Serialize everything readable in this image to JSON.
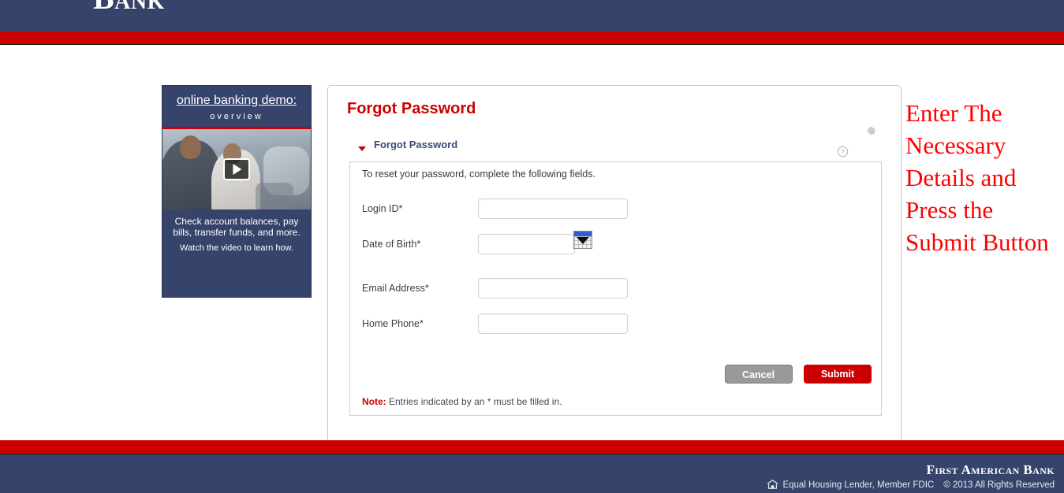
{
  "header": {
    "logo_text": "Bank",
    "nav_bar_color": "#36436b",
    "accent_color": "#cc0000"
  },
  "promo": {
    "title": "online banking demo:",
    "subtitle": "overview",
    "play_icon": "play-icon",
    "caption": "Check account balances, pay bills, transfer funds, and more.",
    "caption_sub": "Watch the video to learn how."
  },
  "form_card": {
    "page_title": "Forgot Password",
    "gear_icon": "gear-icon",
    "help_icon": "help-icon",
    "section_title": "Forgot Password",
    "instruction": "To reset your password, complete the following fields.",
    "fields": [
      {
        "label": "Login ID*",
        "value": "",
        "placeholder": "",
        "type": "text"
      },
      {
        "label": "Date of Birth*",
        "value": "",
        "placeholder": "",
        "type": "date",
        "icon": "calendar-icon"
      },
      {
        "label": "Email Address*",
        "value": "",
        "placeholder": "",
        "type": "email"
      },
      {
        "label": "Home Phone*",
        "value": "",
        "placeholder": "",
        "type": "tel"
      }
    ],
    "buttons": {
      "cancel": "Cancel",
      "submit": "Submit"
    },
    "note_word": "Note:",
    "note_text": " Entries indicated by an * must be filled in."
  },
  "annotation": {
    "text": "Enter The Necessary Details and Press the Submit Button",
    "color": "#ff0000"
  },
  "footer": {
    "brand": "First American Bank",
    "housing_icon": "equal-housing-lender-icon",
    "legal": "Equal Housing Lender, Member FDIC",
    "copyright": "© 2013 All Rights Reserved"
  }
}
